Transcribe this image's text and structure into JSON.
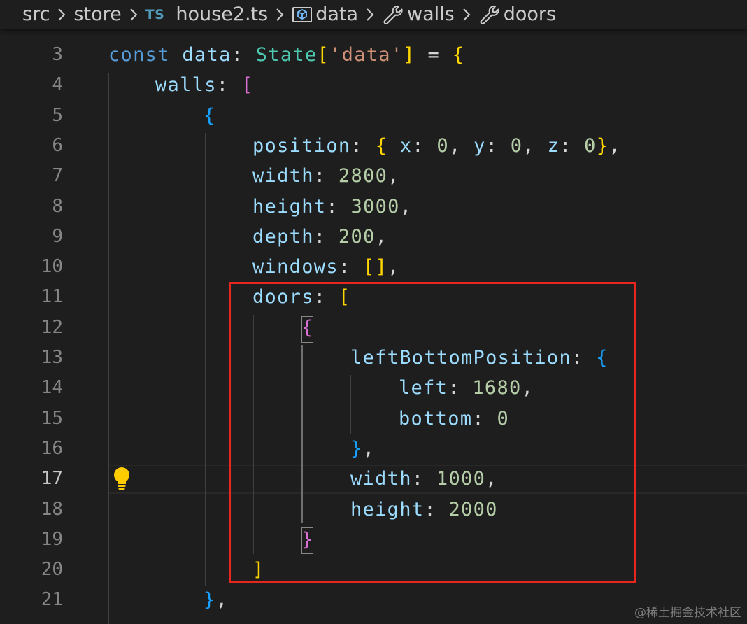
{
  "breadcrumb": {
    "items": [
      {
        "label": "src",
        "icon": "none"
      },
      {
        "label": "store",
        "icon": "none"
      },
      {
        "label": "house2.ts",
        "icon": "typescript-file-icon",
        "badge": "TS"
      },
      {
        "label": "data",
        "icon": "variable-icon"
      },
      {
        "label": "walls",
        "icon": "wrench-icon"
      },
      {
        "label": "doors",
        "icon": "wrench-icon"
      }
    ]
  },
  "editor": {
    "active_line": "17",
    "lines": [
      {
        "number": "3",
        "tokens": [
          {
            "t": "const ",
            "c": "kw"
          },
          {
            "t": "data",
            "c": "var"
          },
          {
            "t": ": ",
            "c": "pun"
          },
          {
            "t": "State",
            "c": "type"
          },
          {
            "t": "[",
            "c": "br1"
          },
          {
            "t": "'data'",
            "c": "str"
          },
          {
            "t": "]",
            "c": "br1"
          },
          {
            "t": " = ",
            "c": "pun"
          },
          {
            "t": "{",
            "c": "br1"
          }
        ]
      },
      {
        "number": "4",
        "tokens": [
          {
            "t": "walls",
            "c": "var"
          },
          {
            "t": ": ",
            "c": "pun"
          },
          {
            "t": "[",
            "c": "br2"
          }
        ]
      },
      {
        "number": "5",
        "tokens": [
          {
            "t": "{",
            "c": "br3"
          }
        ]
      },
      {
        "number": "6",
        "tokens": [
          {
            "t": "position",
            "c": "var"
          },
          {
            "t": ": ",
            "c": "pun"
          },
          {
            "t": "{",
            "c": "br1"
          },
          {
            "t": " x",
            "c": "var"
          },
          {
            "t": ": ",
            "c": "pun"
          },
          {
            "t": "0",
            "c": "num"
          },
          {
            "t": ", ",
            "c": "pun"
          },
          {
            "t": "y",
            "c": "var"
          },
          {
            "t": ": ",
            "c": "pun"
          },
          {
            "t": "0",
            "c": "num"
          },
          {
            "t": ", ",
            "c": "pun"
          },
          {
            "t": "z",
            "c": "var"
          },
          {
            "t": ": ",
            "c": "pun"
          },
          {
            "t": "0",
            "c": "num"
          },
          {
            "t": "}",
            "c": "br1"
          },
          {
            "t": ",",
            "c": "pun"
          }
        ]
      },
      {
        "number": "7",
        "tokens": [
          {
            "t": "width",
            "c": "var"
          },
          {
            "t": ": ",
            "c": "pun"
          },
          {
            "t": "2800",
            "c": "num"
          },
          {
            "t": ",",
            "c": "pun"
          }
        ]
      },
      {
        "number": "8",
        "tokens": [
          {
            "t": "height",
            "c": "var"
          },
          {
            "t": ": ",
            "c": "pun"
          },
          {
            "t": "3000",
            "c": "num"
          },
          {
            "t": ",",
            "c": "pun"
          }
        ]
      },
      {
        "number": "9",
        "tokens": [
          {
            "t": "depth",
            "c": "var"
          },
          {
            "t": ": ",
            "c": "pun"
          },
          {
            "t": "200",
            "c": "num"
          },
          {
            "t": ",",
            "c": "pun"
          }
        ]
      },
      {
        "number": "10",
        "tokens": [
          {
            "t": "windows",
            "c": "var"
          },
          {
            "t": ": ",
            "c": "pun"
          },
          {
            "t": "[]",
            "c": "br1"
          },
          {
            "t": ",",
            "c": "pun"
          }
        ]
      },
      {
        "number": "11",
        "tokens": [
          {
            "t": "doors",
            "c": "var"
          },
          {
            "t": ": ",
            "c": "pun"
          },
          {
            "t": "[",
            "c": "br1"
          }
        ]
      },
      {
        "number": "12",
        "tokens": [
          {
            "t": "{",
            "c": "br2"
          }
        ]
      },
      {
        "number": "13",
        "tokens": [
          {
            "t": "leftBottomPosition",
            "c": "var"
          },
          {
            "t": ": ",
            "c": "pun"
          },
          {
            "t": "{",
            "c": "br3"
          }
        ]
      },
      {
        "number": "14",
        "tokens": [
          {
            "t": "left",
            "c": "var"
          },
          {
            "t": ": ",
            "c": "pun"
          },
          {
            "t": "1680",
            "c": "num"
          },
          {
            "t": ",",
            "c": "pun"
          }
        ]
      },
      {
        "number": "15",
        "tokens": [
          {
            "t": "bottom",
            "c": "var"
          },
          {
            "t": ": ",
            "c": "pun"
          },
          {
            "t": "0",
            "c": "num"
          }
        ]
      },
      {
        "number": "16",
        "tokens": [
          {
            "t": "}",
            "c": "br3"
          },
          {
            "t": ",",
            "c": "pun"
          }
        ]
      },
      {
        "number": "17",
        "tokens": [
          {
            "t": "width",
            "c": "var"
          },
          {
            "t": ": ",
            "c": "pun"
          },
          {
            "t": "1000",
            "c": "num"
          },
          {
            "t": ",",
            "c": "pun"
          }
        ]
      },
      {
        "number": "18",
        "tokens": [
          {
            "t": "height",
            "c": "var"
          },
          {
            "t": ": ",
            "c": "pun"
          },
          {
            "t": "2000",
            "c": "num"
          }
        ]
      },
      {
        "number": "19",
        "tokens": [
          {
            "t": "}",
            "c": "br2"
          }
        ]
      },
      {
        "number": "20",
        "tokens": [
          {
            "t": "]",
            "c": "br1"
          }
        ]
      },
      {
        "number": "21",
        "tokens": [
          {
            "t": "}",
            "c": "br3"
          },
          {
            "t": ",",
            "c": "pun"
          }
        ]
      }
    ]
  },
  "colors": {
    "highlight_box": "#e8261e",
    "lightbulb": "#ffcc00",
    "keyword": "#569cd6",
    "property": "#9cdcfe",
    "type": "#4ec9b0",
    "string": "#ce9178",
    "number": "#b5cea8"
  },
  "icons": {
    "lightbulb": "lightbulb-icon",
    "separator": "chevron-right-icon"
  },
  "watermark": "@稀土掘金技术社区"
}
